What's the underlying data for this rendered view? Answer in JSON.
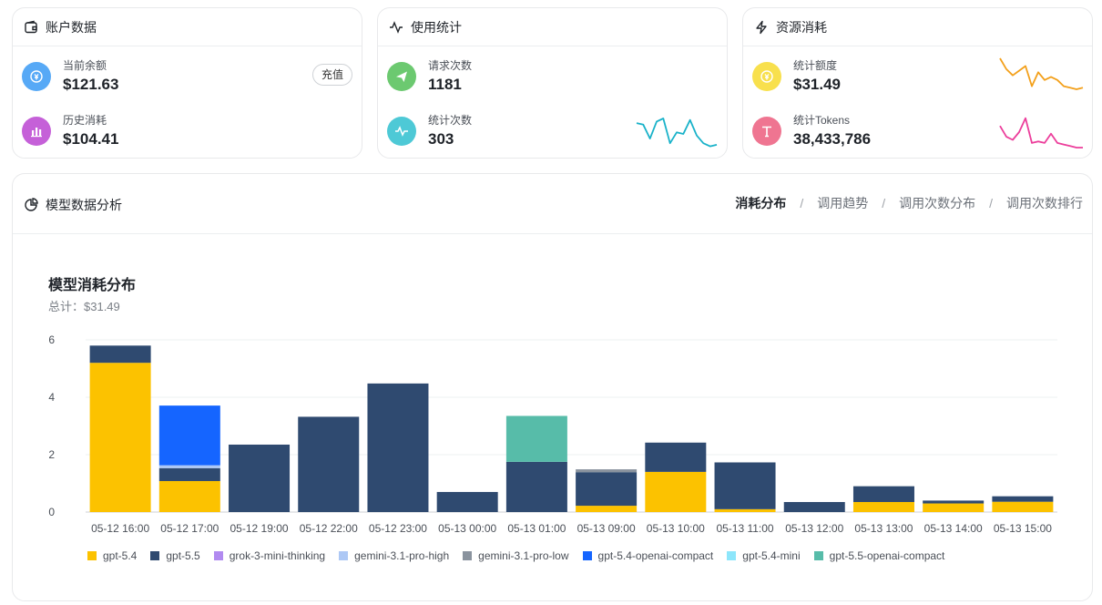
{
  "account": {
    "title": "账户数据",
    "balance_label": "当前余额",
    "balance_value": "$121.63",
    "recharge_label": "充值",
    "history_label": "历史消耗",
    "history_value": "$104.41"
  },
  "usage": {
    "title": "使用统计",
    "requests_label": "请求次数",
    "requests_value": "1181",
    "stat_count_label": "统计次数",
    "stat_count_value": "303",
    "spark": [
      0.85,
      0.8,
      0.35,
      0.9,
      1.0,
      0.2,
      0.55,
      0.5,
      0.95,
      0.45,
      0.2,
      0.1,
      0.15
    ]
  },
  "resource": {
    "title": "资源消耗",
    "quota_label": "统计额度",
    "quota_value": "$31.49",
    "tokens_label": "统计Tokens",
    "tokens_value": "38,433,786",
    "quota_spark": [
      1.0,
      0.65,
      0.45,
      0.6,
      0.75,
      0.1,
      0.55,
      0.3,
      0.4,
      0.3,
      0.1,
      0.05,
      0.0,
      0.05
    ],
    "tokens_spark": [
      0.7,
      0.35,
      0.25,
      0.5,
      0.95,
      0.15,
      0.2,
      0.15,
      0.45,
      0.15,
      0.1,
      0.05,
      0.0,
      0.0
    ]
  },
  "analysis": {
    "title": "模型数据分析",
    "tabs": [
      "消耗分布",
      "调用趋势",
      "调用次数分布",
      "调用次数排行"
    ],
    "tab_sep": "/",
    "active_tab": 0
  },
  "colors": {
    "gpt-5.4": "#fcc200",
    "gpt-5.5": "#2f4a70",
    "grok-3-mini-thinking": "#b18af0",
    "gemini-3.1-pro-high": "#adc8f5",
    "gemini-3.1-pro-low": "#8a939e",
    "gpt-5.4-openai-compact": "#1565ff",
    "gpt-5.4-mini": "#8de6fb",
    "gpt-5.5-openai-compact": "#57bca9",
    "blue_icon": "#57a9f6",
    "purple_icon": "#c560d8",
    "green_icon": "#6cc970",
    "cyan_icon": "#4ec9d6",
    "yellow_icon": "#f8e04d",
    "pink_icon": "#ef7591",
    "spark_cyan": "#19b2c9",
    "spark_orange": "#f3a01b",
    "spark_pink": "#ec3e9b"
  },
  "chart_data": {
    "type": "bar",
    "stacked": true,
    "title": "模型消耗分布",
    "subtitle": "总计：$31.49",
    "xlabel": "",
    "ylabel": "",
    "ylim": [
      0,
      6
    ],
    "yticks": [
      "0",
      "2",
      "4",
      "6"
    ],
    "grid": true,
    "legend_position": "bottom",
    "categories": [
      "05-12 16:00",
      "05-12 17:00",
      "05-12 19:00",
      "05-12 22:00",
      "05-12 23:00",
      "05-13 00:00",
      "05-13 01:00",
      "05-13 09:00",
      "05-13 10:00",
      "05-13 11:00",
      "05-13 12:00",
      "05-13 13:00",
      "05-13 14:00",
      "05-13 15:00"
    ],
    "series": [
      {
        "name": "gpt-5.4",
        "values": [
          5.2,
          1.08,
          0,
          0,
          0,
          0,
          0,
          0.22,
          1.4,
          0.1,
          0,
          0.35,
          0.3,
          0.36
        ]
      },
      {
        "name": "gpt-5.5",
        "values": [
          0.6,
          0.45,
          2.35,
          3.32,
          4.48,
          0.7,
          1.75,
          1.17,
          1.02,
          1.63,
          0.35,
          0.55,
          0.1,
          0.19
        ]
      },
      {
        "name": "grok-3-mini-thinking",
        "values": [
          0,
          0,
          0,
          0,
          0,
          0,
          0,
          0,
          0,
          0,
          0,
          0,
          0,
          0
        ]
      },
      {
        "name": "gemini-3.1-pro-high",
        "values": [
          0,
          0.1,
          0,
          0,
          0,
          0,
          0,
          0,
          0,
          0,
          0,
          0,
          0,
          0
        ]
      },
      {
        "name": "gemini-3.1-pro-low",
        "values": [
          0,
          0,
          0,
          0,
          0,
          0,
          0,
          0.1,
          0,
          0,
          0,
          0,
          0,
          0
        ]
      },
      {
        "name": "gpt-5.4-openai-compact",
        "values": [
          0,
          2.08,
          0,
          0,
          0,
          0,
          0,
          0,
          0,
          0,
          0,
          0,
          0,
          0
        ]
      },
      {
        "name": "gpt-5.4-mini",
        "values": [
          0,
          0,
          0,
          0,
          0,
          0,
          0,
          0,
          0,
          0,
          0,
          0,
          0,
          0
        ]
      },
      {
        "name": "gpt-5.5-openai-compact",
        "values": [
          0,
          0,
          0,
          0,
          0,
          0,
          1.6,
          0,
          0,
          0,
          0,
          0,
          0,
          0
        ]
      }
    ]
  }
}
